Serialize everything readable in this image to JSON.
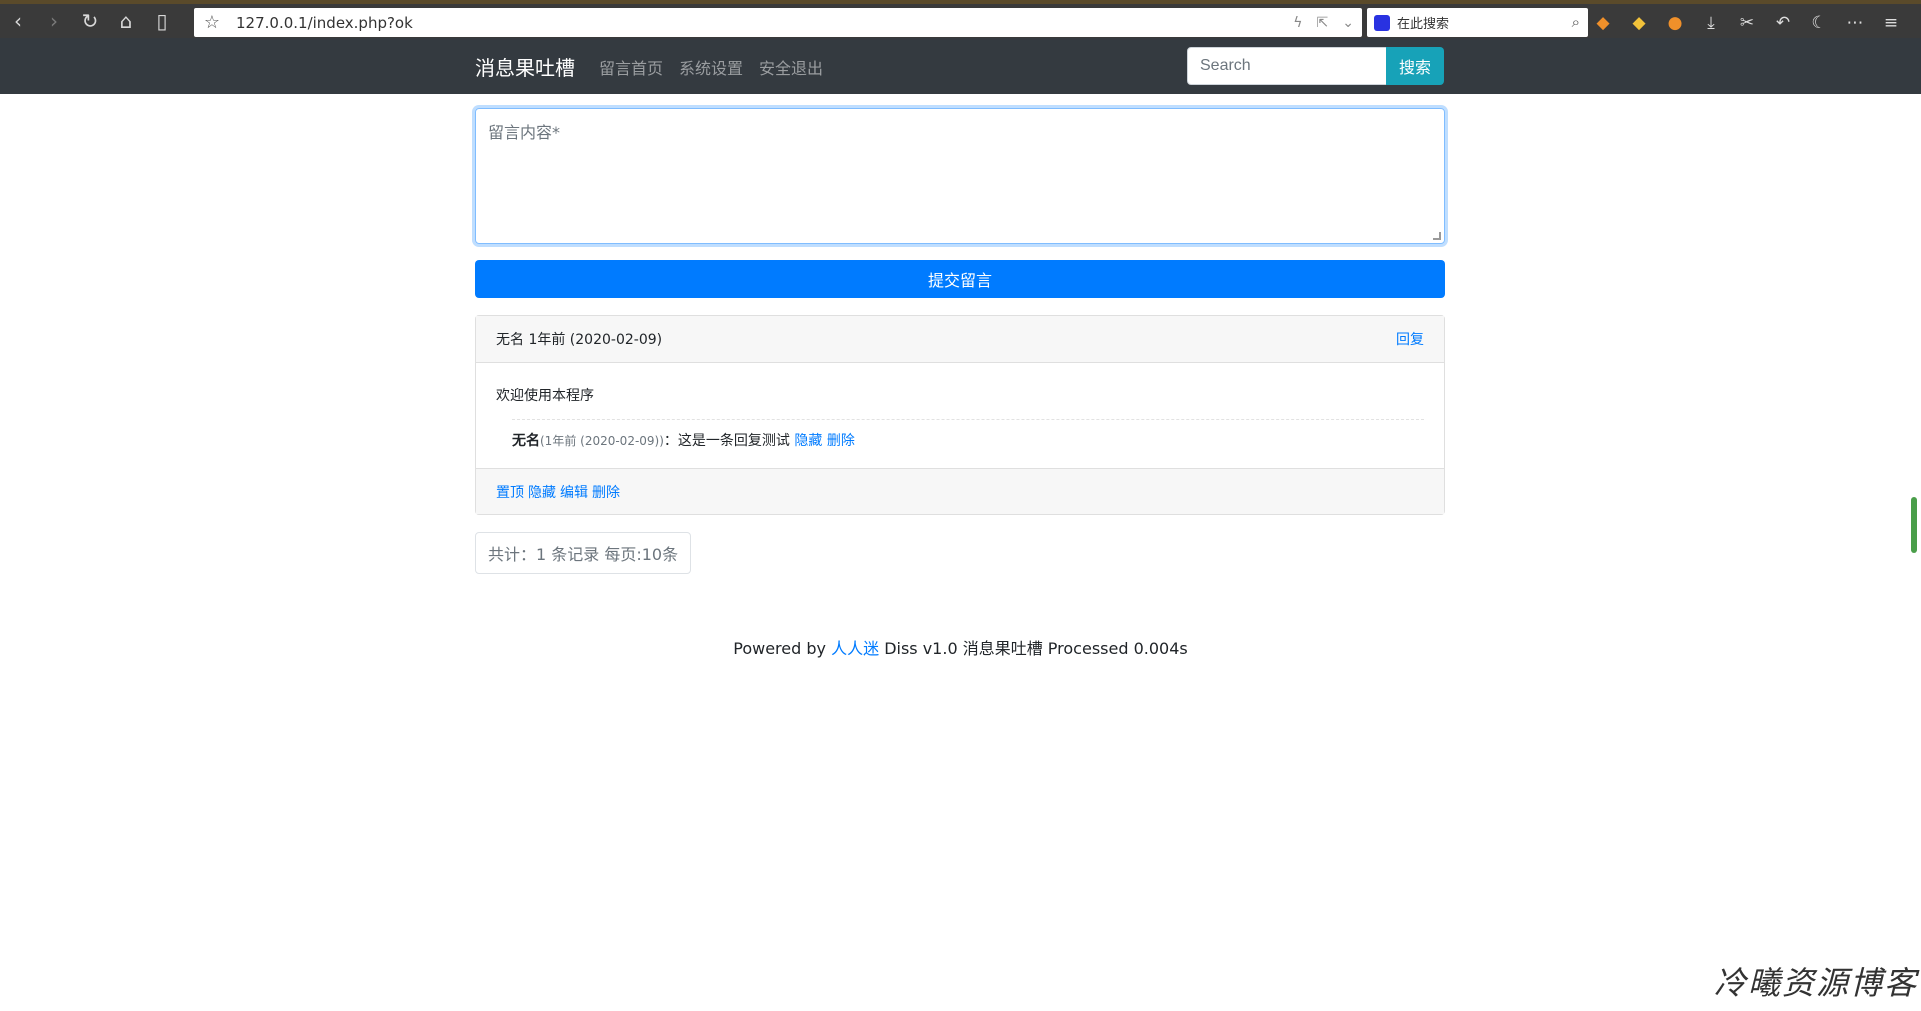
{
  "browser": {
    "url": "127.0.0.1/index.php?ok",
    "search_placeholder": "在此搜索"
  },
  "navbar": {
    "brand": "消息果吐槽",
    "links": [
      "留言首页",
      "系统设置",
      "安全退出"
    ],
    "search_placeholder": "Search",
    "search_button": "搜索"
  },
  "form": {
    "content_placeholder": "留言内容*",
    "submit_label": "提交留言"
  },
  "message": {
    "author": "无名",
    "time": "1年前 (2020-02-09)",
    "reply_label": "回复",
    "body": "欢迎使用本程序",
    "reply": {
      "author": "无名",
      "meta": "(1年前 (2020-02-09))",
      "colon": "：",
      "text": "这是一条回复测试",
      "hide_label": "隐藏",
      "delete_label": "删除"
    },
    "actions": {
      "pin": "置顶",
      "hide": "隐藏",
      "edit": "编辑",
      "delete": "删除"
    }
  },
  "pager": {
    "summary": "共计：1 条记录 每页:10条"
  },
  "footer": {
    "powered_by": "Powered by",
    "author_link": "人人迷",
    "rest": "Diss v1.0 消息果吐槽 Processed 0.004s"
  },
  "watermark": "冷曦资源博客"
}
